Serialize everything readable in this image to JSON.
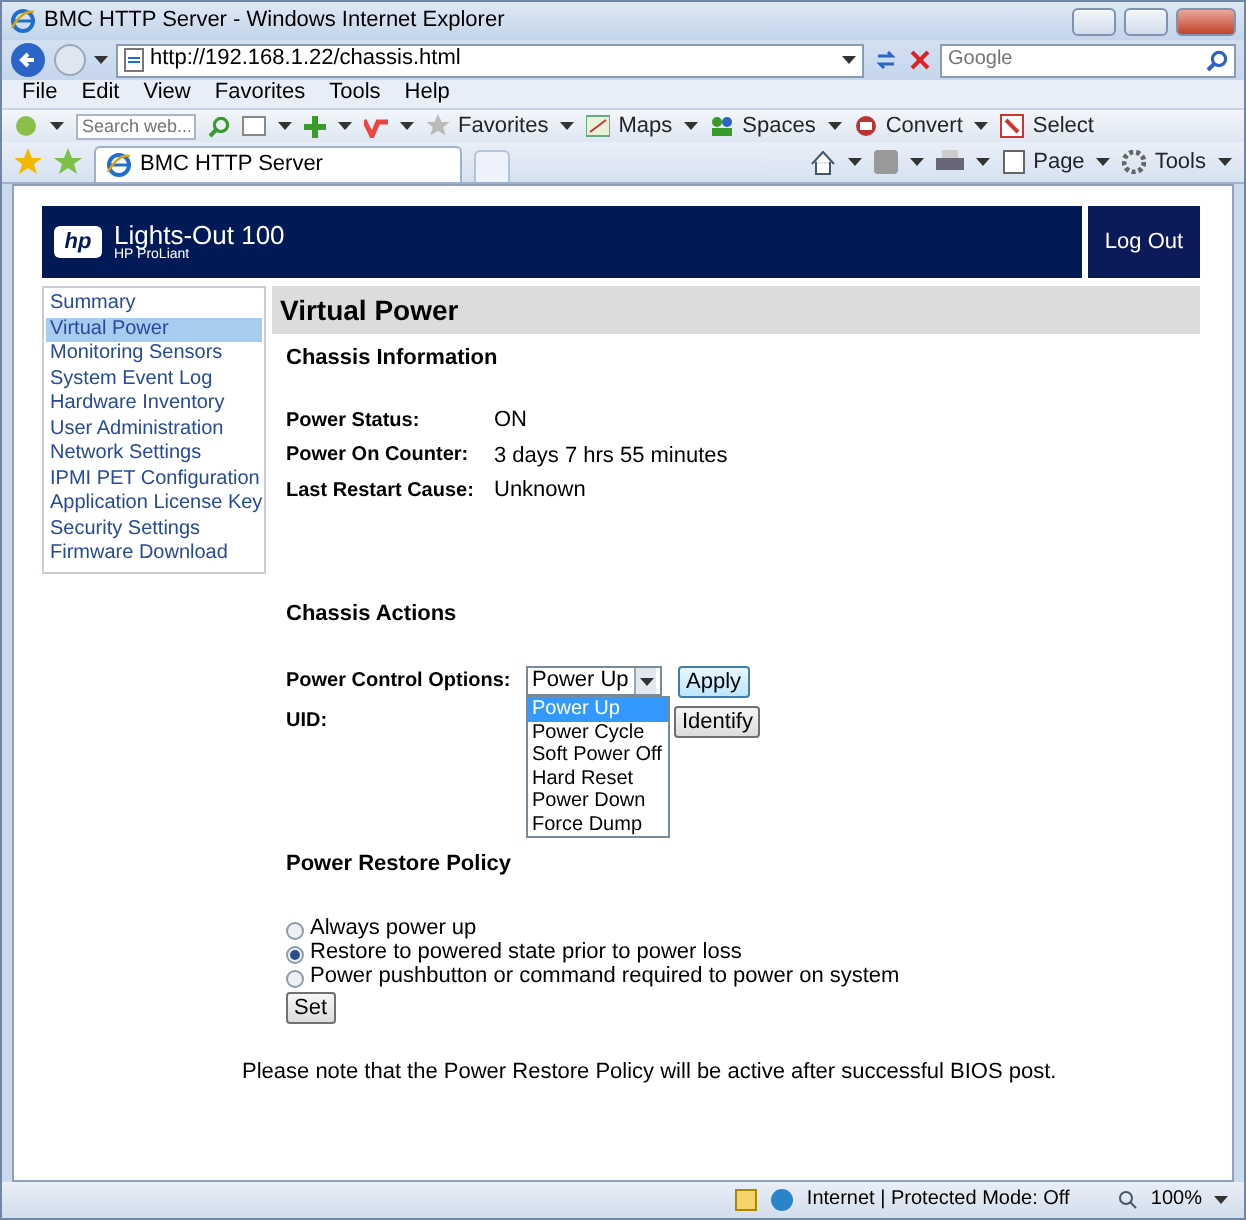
{
  "window": {
    "title": "BMC HTTP Server - Windows Internet Explorer"
  },
  "address_bar": {
    "url": "http://192.168.1.22/chassis.html",
    "search_placeholder": "Google"
  },
  "menu": [
    "File",
    "Edit",
    "View",
    "Favorites",
    "Tools",
    "Help"
  ],
  "toolbar": {
    "search_placeholder": "Search web...",
    "items": [
      {
        "kind": "star",
        "label": "Favorites"
      },
      {
        "kind": "map",
        "label": "Maps"
      },
      {
        "kind": "people",
        "label": "Spaces"
      },
      {
        "kind": "convert",
        "label": "Convert"
      },
      {
        "kind": "select",
        "label": "Select"
      }
    ]
  },
  "tab": {
    "label": "BMC HTTP Server"
  },
  "command_bar": [
    {
      "kind": "page",
      "label": "Page"
    },
    {
      "kind": "tools",
      "label": "Tools"
    }
  ],
  "page": {
    "header": {
      "logo_mark": "hp",
      "product": "Lights-Out 100",
      "subtitle": "HP ProLiant",
      "logout": "Log Out"
    },
    "nav": [
      {
        "label": "Summary",
        "selected": false
      },
      {
        "label": "Virtual Power",
        "selected": true
      },
      {
        "label": "Monitoring Sensors",
        "selected": false
      },
      {
        "label": "System Event Log",
        "selected": false
      },
      {
        "label": "Hardware Inventory",
        "selected": false
      },
      {
        "label": "User Administration",
        "selected": false
      },
      {
        "label": "Network Settings",
        "selected": false
      },
      {
        "label": "IPMI PET Configuration",
        "selected": false
      },
      {
        "label": "Application License Key",
        "selected": false
      },
      {
        "label": "Security Settings",
        "selected": false
      },
      {
        "label": "Firmware Download",
        "selected": false
      }
    ],
    "title": "Virtual Power",
    "chassis_information": {
      "heading": "Chassis Information",
      "fields": [
        {
          "label": "Power Status:",
          "value": "ON"
        },
        {
          "label": "Power On Counter:",
          "value": "3 days 7 hrs 55 minutes"
        },
        {
          "label": "Last Restart Cause:",
          "value": "Unknown"
        }
      ]
    },
    "chassis_actions": {
      "heading": "Chassis Actions",
      "power_control": {
        "label": "Power Control Options:",
        "value": "Power Up",
        "button": "Apply",
        "options": [
          {
            "label": "Power Up",
            "selected": true
          },
          {
            "label": "Power Cycle",
            "selected": false
          },
          {
            "label": "Soft Power Off",
            "selected": false
          },
          {
            "label": "Hard Reset",
            "selected": false
          },
          {
            "label": "Power Down",
            "selected": false
          },
          {
            "label": "Force Dump",
            "selected": false
          }
        ]
      },
      "uid": {
        "label": "UID:",
        "button": "Identify"
      }
    },
    "power_restore_policy": {
      "heading": "Power Restore Policy",
      "options": [
        {
          "label": "Always power up",
          "selected": false
        },
        {
          "label": "Restore to powered state prior to power loss",
          "selected": true
        },
        {
          "label": "Power pushbutton or command required to power on system",
          "selected": false
        }
      ],
      "button": "Set",
      "note": "Please note that the Power Restore Policy will be active after successful BIOS post."
    }
  },
  "status_bar": {
    "zone": "Internet | Protected Mode: Off",
    "zoom": "100%"
  }
}
